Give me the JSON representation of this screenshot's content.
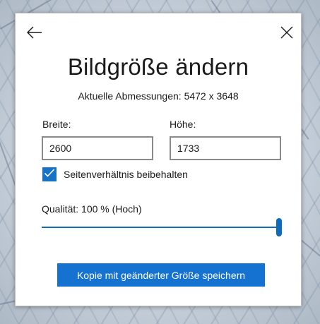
{
  "dialog": {
    "title": "Bildgröße ändern",
    "current_dimensions": "Aktuelle Abmessungen: 5472 x 3648",
    "width": {
      "label": "Breite:",
      "value": "2600"
    },
    "height": {
      "label": "Höhe:",
      "value": "1733"
    },
    "keep_aspect_ratio": {
      "label": "Seitenverhältnis beibehalten",
      "checked": true
    },
    "quality": {
      "label": "Qualität: 100 % (Hoch)",
      "value_percent": 100
    },
    "save_button_label": "Kopie mit geänderter Größe speichern",
    "icons": {
      "back": "arrow-left-icon",
      "close": "close-icon",
      "check": "checkmark-icon"
    }
  },
  "colors": {
    "accent": "#0f6cbd",
    "button": "#1672d0",
    "text": "#1a1a1a",
    "field_border": "#8a8a8a",
    "dialog_bg": "#ffffff"
  }
}
